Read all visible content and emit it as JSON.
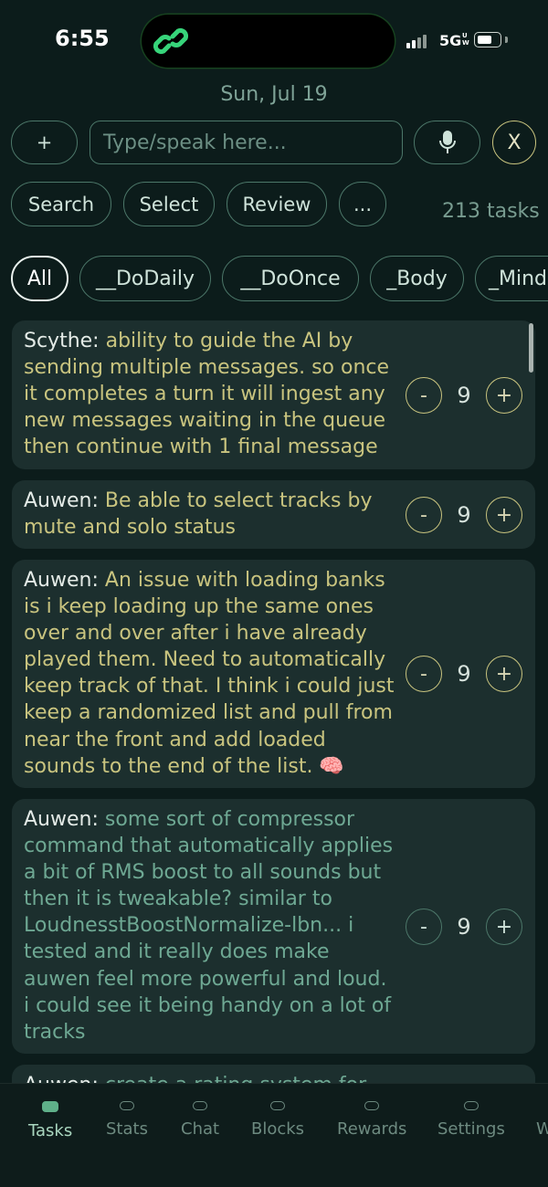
{
  "status": {
    "time": "6:55",
    "network": "5G",
    "network_sub": "U\nW"
  },
  "header": {
    "date": "Sun, Jul 19"
  },
  "input": {
    "add_label": "+",
    "placeholder": "Type/speak here...",
    "clear_label": "X"
  },
  "actions": {
    "search": "Search",
    "select": "Select",
    "review": "Review",
    "more": "...",
    "task_count": "213 tasks"
  },
  "filters": [
    "All",
    "__DoDaily",
    "__DoOnce",
    "_Body",
    "_Mind"
  ],
  "tasks": [
    {
      "author": "Scythe:",
      "text": "ability to guide the AI by sending multiple messages. so once it completes a turn it will ingest any new messages waiting in the queue then continue with 1 final message",
      "value": "9",
      "minus": "-",
      "plus": "+"
    },
    {
      "author": "Auwen:",
      "text": "Be able to select tracks by mute and solo status",
      "value": "9",
      "minus": "-",
      "plus": "+"
    },
    {
      "author": "Auwen:",
      "text": "An issue with loading banks is i keep loading up the same ones over and over after i have already played them. Need to automatically keep track of that. I think i could just keep a randomized list and pull from near the front and add loaded sounds to the end of the list. 🧠",
      "value": "9",
      "minus": "-",
      "plus": "+"
    },
    {
      "author": "Auwen:",
      "text": "some sort of compressor command that automatically applies a bit of RMS boost to all sounds but then it is tweakable? similar to LoudnesstBoostNormalize-lbn... i tested and it really does make auwen feel more powerful and loud. i could see it being handy on a lot of tracks",
      "value": "9",
      "minus": "-",
      "plus": "+"
    },
    {
      "author": "Auwen:",
      "text": "create a rating system for",
      "value": "",
      "minus": "",
      "plus": ""
    }
  ],
  "tabs": [
    "Tasks",
    "Stats",
    "Chat",
    "Blocks",
    "Rewards",
    "Settings",
    "W"
  ],
  "colors": {
    "background": "#0c1c1b",
    "card": "#1c2f2e",
    "accent_yellow": "#c9c47f",
    "accent_green": "#6ea893",
    "border": "#4c7769",
    "active_tab": "#5fb08a"
  }
}
